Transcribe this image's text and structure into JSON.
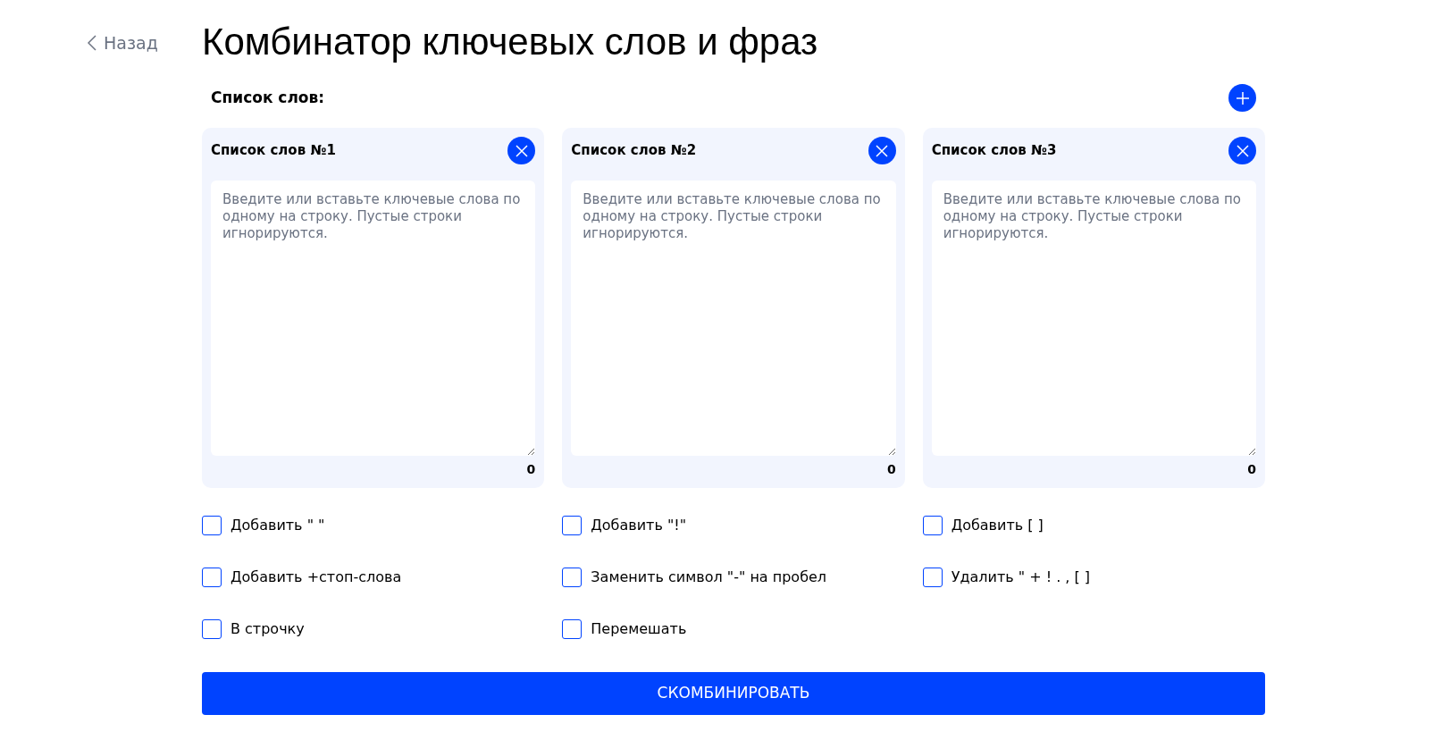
{
  "back_link": {
    "label": "Назад"
  },
  "title": "Комбинатор ключевых слов и фраз",
  "section_label": "Список слов:",
  "lists": [
    {
      "title": "Список слов №1",
      "placeholder": "Введите или вставьте ключевые слова по одному на строку. Пустые строки игнорируются.",
      "count": "0"
    },
    {
      "title": "Список слов №2",
      "placeholder": "Введите или вставьте ключевые слова по одному на строку. Пустые строки игнорируются.",
      "count": "0"
    },
    {
      "title": "Список слов №3",
      "placeholder": "Введите или вставьте ключевые слова по одному на строку. Пустые строки игнорируются.",
      "count": "0"
    }
  ],
  "options": [
    {
      "label": "Добавить \" \"",
      "checked": false
    },
    {
      "label": "Добавить \"!\"",
      "checked": false
    },
    {
      "label": "Добавить [ ]",
      "checked": false
    },
    {
      "label": "Добавить +стоп-слова",
      "checked": false
    },
    {
      "label": "Заменить символ \"-\" на пробел",
      "checked": false
    },
    {
      "label": "Удалить \" + ! . , [ ]",
      "checked": false
    },
    {
      "label": "В строчку",
      "checked": false
    },
    {
      "label": "Перемешать",
      "checked": false
    }
  ],
  "submit_button": "СКОМБИНИРОВАТЬ"
}
